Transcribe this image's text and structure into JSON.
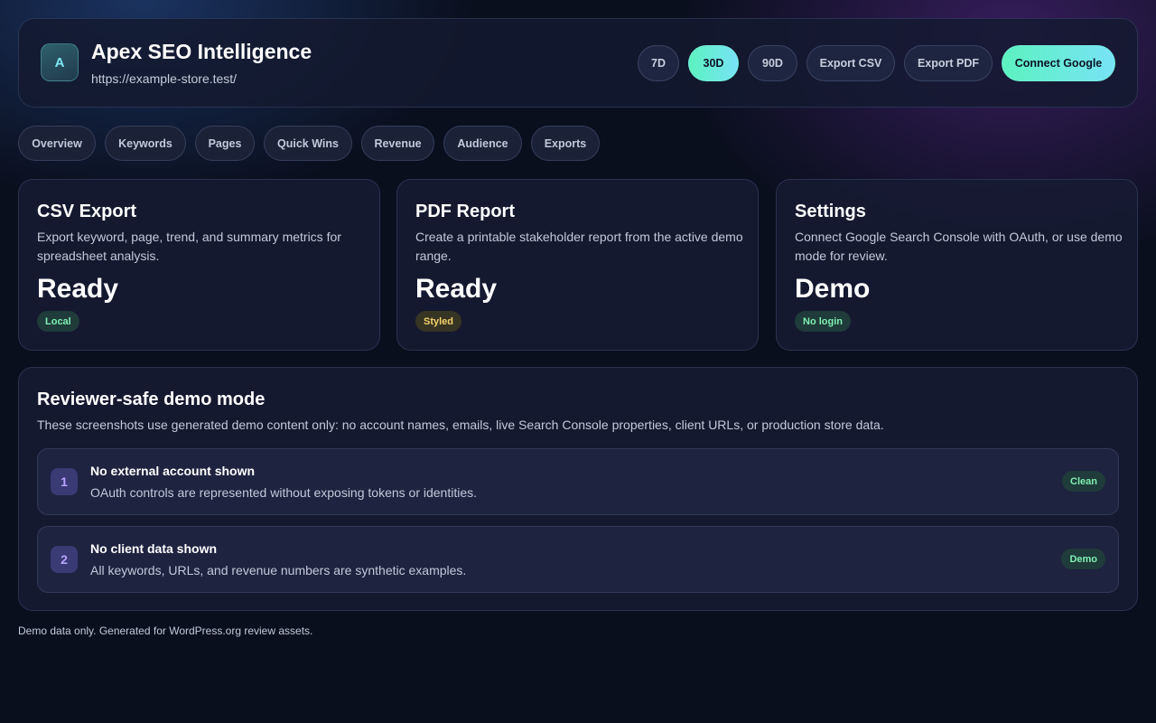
{
  "header": {
    "logo_letter": "A",
    "title": "Apex SEO Intelligence",
    "url": "https://example-store.test/",
    "buttons": [
      "7D",
      "30D",
      "90D",
      "Export CSV",
      "Export PDF",
      "Connect Google"
    ],
    "active_range": "30D"
  },
  "tabs": [
    "Overview",
    "Keywords",
    "Pages",
    "Quick Wins",
    "Revenue",
    "Audience",
    "Exports"
  ],
  "active_tab": "Exports",
  "cards": [
    {
      "title": "CSV Export",
      "description": "Export keyword, page, trend, and summary metrics for spreadsheet analysis.",
      "value": "Ready",
      "badge": "Local"
    },
    {
      "title": "PDF Report",
      "description": "Create a printable stakeholder report from the active demo range.",
      "value": "Ready",
      "badge": "Styled"
    },
    {
      "title": "Settings",
      "description": "Connect Google Search Console with OAuth, or use demo mode for review.",
      "value": "Demo",
      "badge": "No login"
    }
  ],
  "panel": {
    "title": "Reviewer-safe demo mode",
    "description": "These screenshots use generated demo content only: no account names, emails, live Search Console properties, client URLs, or production store data.",
    "items": [
      {
        "number": "1",
        "title": "No external account shown",
        "description": "OAuth controls are represented without exposing tokens or identities.",
        "badge": "Clean"
      },
      {
        "number": "2",
        "title": "No client data shown",
        "description": "All keywords, URLs, and revenue numbers are synthetic examples.",
        "badge": "Demo"
      }
    ]
  },
  "footer": "Demo data only. Generated for WordPress.org review assets.",
  "colors": {
    "accent_start": "#5cf2c0",
    "accent_end": "#78e3f6",
    "badge_green": "#7ff0b2",
    "badge_yellow": "#f5d26b",
    "background": "#0a0f1e"
  }
}
